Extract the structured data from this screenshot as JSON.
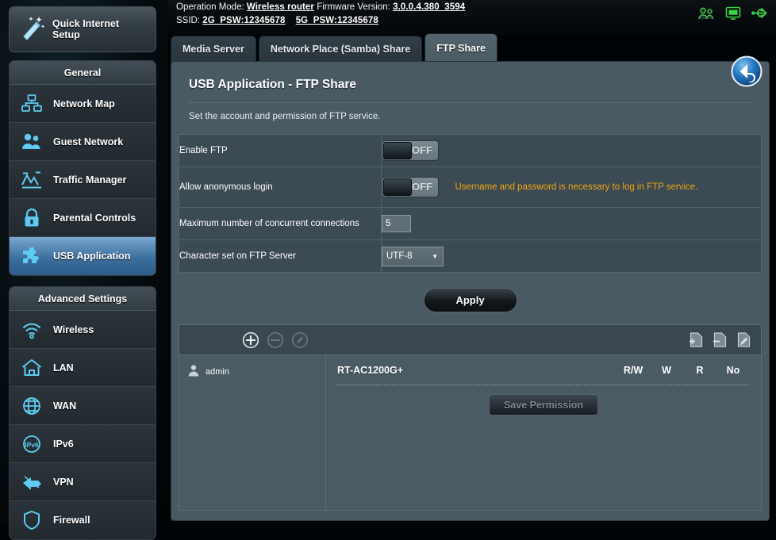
{
  "header": {
    "operation_mode_label": "Operation Mode:",
    "operation_mode_value": "Wireless router",
    "firmware_label": "Firmware Version:",
    "firmware_value": "3.0.0.4.380_3594",
    "ssid_label": "SSID:",
    "ssid_2g": "2G_PSW:12345678",
    "ssid_5g": "5G_PSW:12345678",
    "icons": [
      "clients-icon",
      "monitor-icon",
      "usb-icon"
    ]
  },
  "tabs": [
    {
      "label": "Media Server",
      "active": false
    },
    {
      "label": "Network Place (Samba) Share",
      "active": false
    },
    {
      "label": "FTP Share",
      "active": true
    }
  ],
  "page": {
    "title": "USB Application - FTP Share",
    "description": "Set the account and permission of FTP service.",
    "back_button": "back-arrow-icon"
  },
  "form": {
    "rows": [
      {
        "label": "Enable FTP",
        "control": "toggle",
        "state": "OFF",
        "hint": ""
      },
      {
        "label": "Allow anonymous login",
        "control": "toggle",
        "state": "OFF",
        "hint": "Username and password is necessary to log in FTP service."
      },
      {
        "label": "Maximum number of concurrent connections",
        "control": "text",
        "value": "5",
        "hint": ""
      },
      {
        "label": "Character set on FTP Server",
        "control": "select",
        "value": "UTF-8",
        "options": [
          "UTF-8"
        ],
        "hint": ""
      }
    ],
    "apply_label": "Apply"
  },
  "user_panel": {
    "toolbar_left": [
      {
        "name": "add-user-icon",
        "enabled": true
      },
      {
        "name": "remove-user-icon",
        "enabled": false
      },
      {
        "name": "edit-user-icon",
        "enabled": false
      }
    ],
    "toolbar_right": [
      {
        "name": "add-folder-icon",
        "enabled": true
      },
      {
        "name": "remove-folder-icon",
        "enabled": true
      },
      {
        "name": "rename-folder-icon",
        "enabled": true
      }
    ],
    "users": [
      {
        "name": "admin",
        "avatar": "user-avatar-icon"
      }
    ],
    "device_name": "RT-AC1200G+",
    "permission_columns": [
      "R/W",
      "W",
      "R",
      "No"
    ],
    "save_permission_label": "Save Permission"
  },
  "sidebar": {
    "quick_setup": {
      "line1": "Quick Internet",
      "line2": "Setup",
      "icon": "magic-wand-icon"
    },
    "general": {
      "heading": "General",
      "items": [
        {
          "label": "Network Map",
          "icon": "network-map-icon",
          "active": false
        },
        {
          "label": "Guest Network",
          "icon": "guest-network-icon",
          "active": false
        },
        {
          "label": "Traffic Manager",
          "icon": "traffic-manager-icon",
          "active": false
        },
        {
          "label": "Parental Controls",
          "icon": "lock-icon",
          "active": false
        },
        {
          "label": "USB Application",
          "icon": "puzzle-icon",
          "active": true
        }
      ]
    },
    "advanced": {
      "heading": "Advanced Settings",
      "items": [
        {
          "label": "Wireless",
          "icon": "wifi-icon"
        },
        {
          "label": "LAN",
          "icon": "home-icon"
        },
        {
          "label": "WAN",
          "icon": "globe-icon"
        },
        {
          "label": "IPv6",
          "icon": "ipv6-icon"
        },
        {
          "label": "VPN",
          "icon": "vpn-icon"
        },
        {
          "label": "Firewall",
          "icon": "shield-icon"
        }
      ]
    }
  },
  "colors": {
    "panel_bg": "#4a5a63",
    "form_bg": "#3c4a53",
    "accent_blue": "#3c6f9e",
    "hint_orange": "#f0a513",
    "icon_cyan": "#5ecbf2"
  }
}
